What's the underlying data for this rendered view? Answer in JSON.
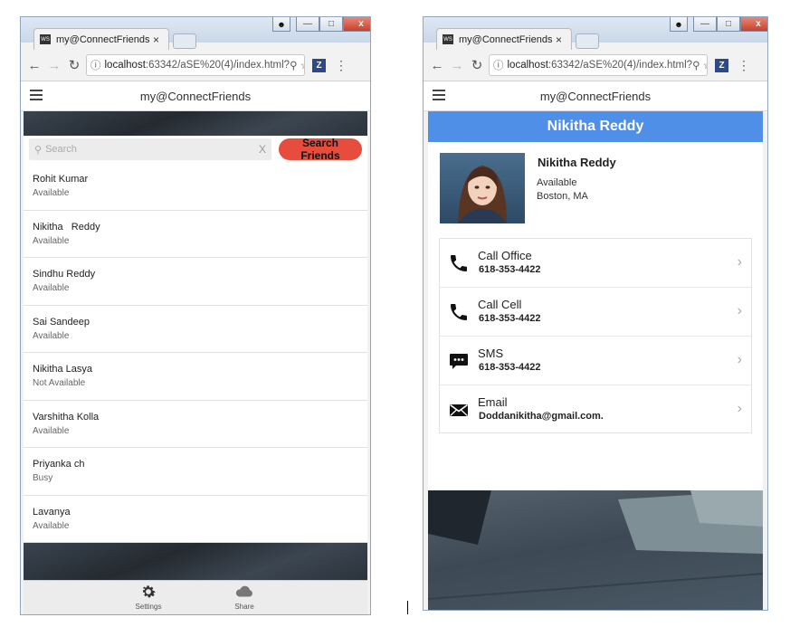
{
  "left": {
    "browser": {
      "tab_title": "my@ConnectFriends",
      "tab_close": "×",
      "url_host": "localhost",
      "url_path": ":63342/aSE%20(4)/index.html?",
      "favicon_text": "WS"
    },
    "app_title": "my@ConnectFriends",
    "search": {
      "placeholder": "Search",
      "clear": "X",
      "button": "Search Friends"
    },
    "contacts": [
      {
        "name": "Rohit Kumar",
        "status": "Available"
      },
      {
        "name": "Nikitha   Reddy",
        "status": "Available"
      },
      {
        "name": "Sindhu Reddy",
        "status": "Available"
      },
      {
        "name": "Sai Sandeep",
        "status": "Available"
      },
      {
        "name": "Nikitha Lasya",
        "status": "Not Available"
      },
      {
        "name": "Varshitha Kolla",
        "status": "Available"
      },
      {
        "name": "Priyanka ch",
        "status": "Busy"
      },
      {
        "name": "Lavanya",
        "status": "Available"
      }
    ],
    "tabs": [
      {
        "label": "Settings",
        "icon": "gear-icon"
      },
      {
        "label": "Share",
        "icon": "cloud-icon"
      }
    ]
  },
  "right": {
    "browser": {
      "tab_title": "my@ConnectFriends",
      "tab_close": "×",
      "url_host": "localhost",
      "url_path": ":63342/aSE%20(4)/index.html?",
      "favicon_text": "WS"
    },
    "app_title": "my@ConnectFriends",
    "header": "Nikitha Reddy",
    "profile": {
      "name": "Nikitha Reddy",
      "status": "Available",
      "location": "Boston, MA"
    },
    "actions": [
      {
        "label": "Call Office",
        "value": "618-353-4422",
        "icon": "phone-icon"
      },
      {
        "label": "Call Cell",
        "value": "618-353-4422",
        "icon": "phone-icon"
      },
      {
        "label": "SMS",
        "value": "618-353-4422",
        "icon": "sms-icon"
      },
      {
        "label": "Email",
        "value": "Doddanikitha@gmail.com.",
        "icon": "mail-icon"
      }
    ],
    "chevron": "›"
  },
  "colors": {
    "accent_red": "#e74c3c",
    "header_blue": "#4f8fe8"
  }
}
